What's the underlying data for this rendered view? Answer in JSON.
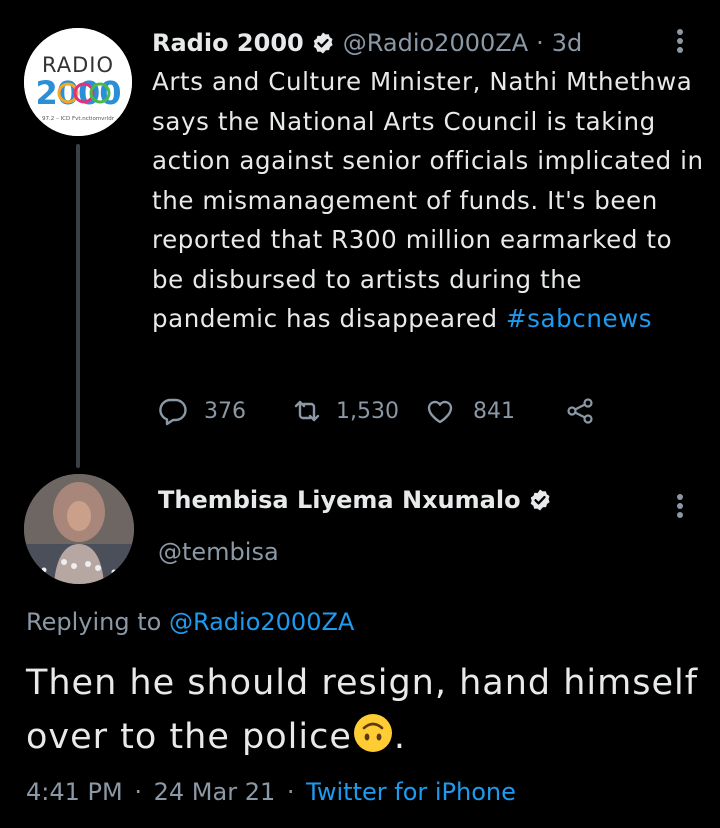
{
  "tweet1": {
    "avatar_text_top": "RADIO",
    "avatar_text_num": "2000",
    "avatar_text_small": "97.2 – ICD Fvt.nctiomvrldr",
    "name": "Radio 2000",
    "handle": "@Radio2000ZA",
    "separator": "·",
    "time": "3d",
    "text": "Arts and Culture Minister, Nathi Mthethwa says the National Arts Council is taking action against senior officials implicated in the mismanagement of funds. It's been reported that R300 million earmarked to be disbursed to artists during the pandemic has disappeared ",
    "hashtag": "#sabcnews",
    "replies": "376",
    "retweets": "1,530",
    "likes": "841"
  },
  "tweet2": {
    "name": "Thembisa Liyema Nxumalo",
    "handle": "@tembisa",
    "replying_prefix": "Replying to ",
    "replying_handle": "@Radio2000ZA",
    "text": "Then he should resign, hand himself over to the police",
    "text_end": ".",
    "time": "4:41 PM",
    "sep1": "·",
    "date": "24 Mar 21",
    "sep2": "·",
    "source": "Twitter for iPhone"
  },
  "colors": {
    "background": "#000000",
    "text": "#e7e9ea",
    "secondary": "#8b98a5",
    "accent": "#1d9bf0"
  },
  "icons": {
    "verified": "verified-badge-icon",
    "more": "more-vertical-icon",
    "reply": "reply-icon",
    "retweet": "retweet-icon",
    "like": "heart-icon",
    "share": "share-icon",
    "emoji": "upside-down-face-emoji"
  }
}
